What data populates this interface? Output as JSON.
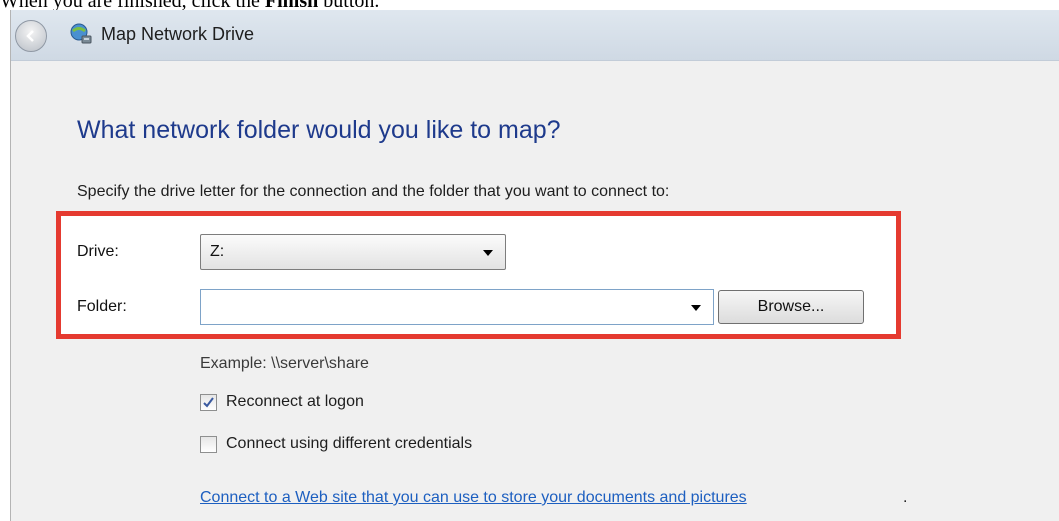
{
  "caption": {
    "prefix": "When you are finished, click the ",
    "bold": "Finish",
    "suffix": " button."
  },
  "window": {
    "title": "Map Network Drive",
    "back_icon": "back-arrow-icon",
    "app_icon": "network-drive-icon"
  },
  "main": {
    "heading": "What network folder would you like to map?",
    "description": "Specify the drive letter for the connection and the folder that you want to connect to:",
    "highlight_color": "#e53a30"
  },
  "form": {
    "drive_label": "Drive:",
    "drive_value": "Z:",
    "folder_label": "Folder:",
    "folder_value": "",
    "browse_label": "Browse...",
    "example": "Example: \\\\server\\share"
  },
  "options": {
    "reconnect_label": "Reconnect at logon",
    "reconnect_checked": true,
    "credentials_label": "Connect using different credentials",
    "credentials_checked": false
  },
  "link": {
    "text": "Connect to a Web site that you can use to store your documents and pictures",
    "trailing": "."
  },
  "colors": {
    "heading": "#1e3a8c",
    "link": "#1d5fc0",
    "window_bg": "#f0f0f0"
  }
}
